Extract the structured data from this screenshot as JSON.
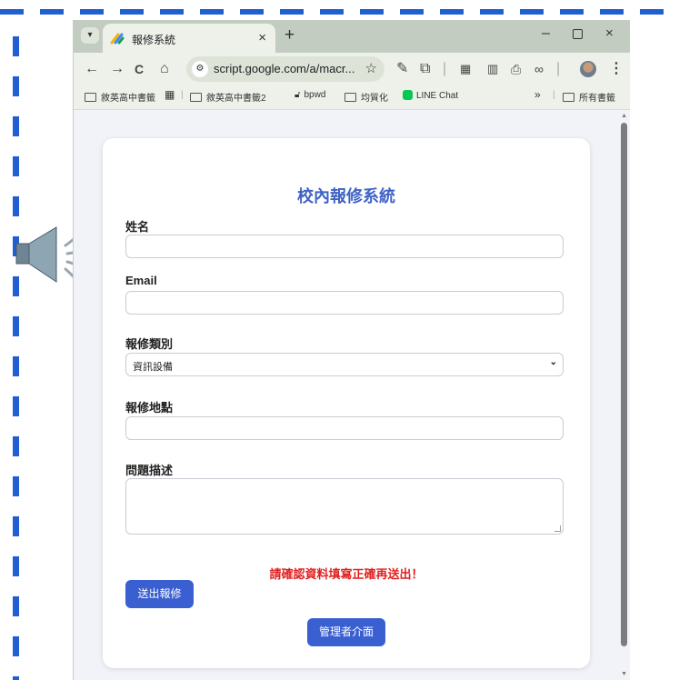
{
  "browser": {
    "tab_title": "報修系統",
    "tab_close": "×",
    "new_tab": "+",
    "window_minimize": "–",
    "window_close": "×",
    "url": "script.google.com/a/macr...",
    "nav_back": "←",
    "nav_forward": "→",
    "reload": "C",
    "home": "⌂",
    "bookmark_star": "☆",
    "menu": "⋮"
  },
  "bookmarks": [
    "敘英高中書籤",
    "敘英高中書籤2",
    "bpwd",
    "均質化",
    "LINE Chat",
    "所有書籤"
  ],
  "bookmarks_more": "»",
  "form": {
    "title": "校內報修系統",
    "name_label": "姓名",
    "name_value": "",
    "email_label": "Email",
    "email_value": "",
    "category_label": "報修類別",
    "category_selected": "資訊設備",
    "location_label": "報修地點",
    "location_value": "",
    "description_label": "問題描述",
    "warning": "請確認資料填寫正確再送出！",
    "submit_label": "送出報修",
    "admin_label": "管理者介面"
  },
  "colors": {
    "accent": "#3a5fd0",
    "title": "#3f63c4",
    "warning": "#e02020",
    "frame_dash": "#1f5fd0",
    "tabbar": "#c3ccc0"
  }
}
